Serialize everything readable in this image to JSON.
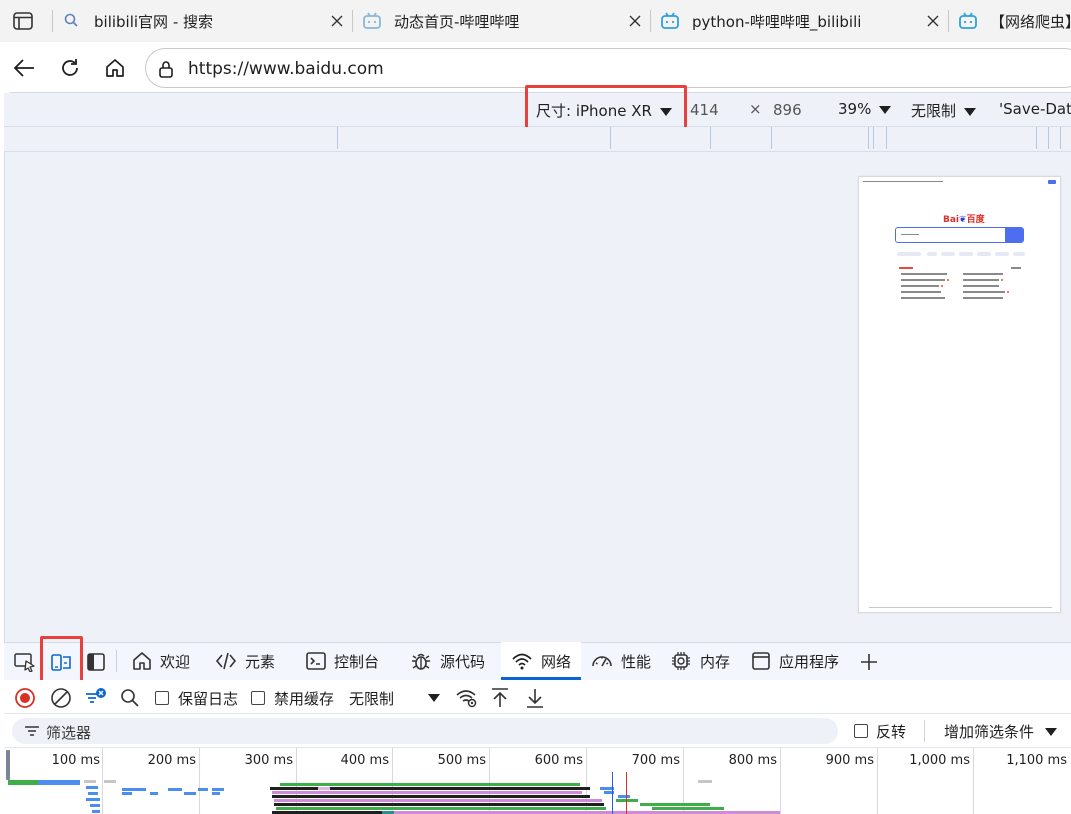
{
  "browser": {
    "tabs": [
      {
        "title": "bilibili官网 - 搜索",
        "icon": "search-icon"
      },
      {
        "title": "动态首页-哔哩哔哩",
        "icon": "bilibili-icon"
      },
      {
        "title": "python-哔哩哔哩_bilibili",
        "icon": "bilibili-icon"
      },
      {
        "title": "【网络爬虫】",
        "icon": "bilibili-icon"
      }
    ],
    "address": "https://www.baidu.com"
  },
  "device_toolbar": {
    "dimensions_label": "尺寸: iPhone XR",
    "width": "414",
    "times": "×",
    "height": "896",
    "zoom": "39%",
    "throttle": "无限制",
    "save_data": "'Save-Data"
  },
  "phone_preview": {
    "logo_left": "Bai",
    "logo_paw": "❦",
    "logo_right": "百度"
  },
  "devtools": {
    "tabs": [
      {
        "label": "欢迎",
        "icon": "home-icon"
      },
      {
        "label": "元素",
        "icon": "code-icon"
      },
      {
        "label": "控制台",
        "icon": "console-icon"
      },
      {
        "label": "源代码",
        "icon": "bug-icon"
      },
      {
        "label": "网络",
        "icon": "wifi-icon",
        "active": true
      },
      {
        "label": "性能",
        "icon": "gauge-icon"
      },
      {
        "label": "内存",
        "icon": "chip-icon"
      },
      {
        "label": "应用程序",
        "icon": "window-icon"
      }
    ],
    "accent": "#0c66d2"
  },
  "network": {
    "preserve_log": "保留日志",
    "disable_cache": "禁用缓存",
    "throttle": "无限制",
    "filter_placeholder": "筛选器",
    "invert": "反转",
    "add_filter": "增加筛选条件",
    "timeline_ticks": [
      "100 ms",
      "200 ms",
      "300 ms",
      "400 ms",
      "500 ms",
      "600 ms",
      "700 ms",
      "800 ms",
      "900 ms",
      "1,000 ms",
      "1,100 ms"
    ]
  },
  "colors": {
    "highlight": "#e8413d",
    "viewport_bg": "#eef1f8"
  }
}
